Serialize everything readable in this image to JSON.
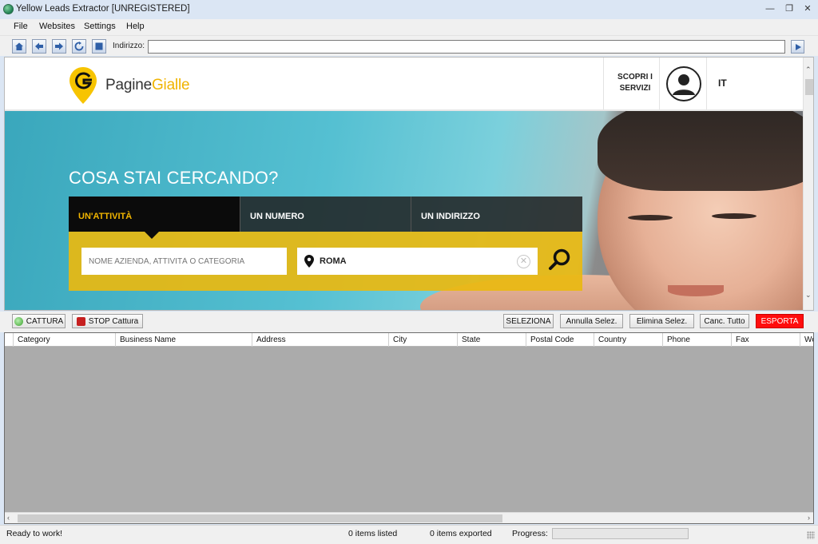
{
  "window": {
    "title": "Yellow Leads Extractor [UNREGISTERED]",
    "controls": [
      "minimize",
      "restore",
      "close"
    ]
  },
  "menu": {
    "items": [
      "File",
      "Websites",
      "Settings",
      "Help"
    ]
  },
  "toolbar": {
    "buttons": [
      "home-icon",
      "back-icon",
      "forward-icon",
      "refresh-icon",
      "stop-icon"
    ],
    "address_label": "Indirizzo:",
    "address_value": "",
    "go_icon": "play-icon"
  },
  "site": {
    "logo_part1": "Pagine",
    "logo_part2": "Gialle",
    "scopri_line1": "SCOPRI I",
    "scopri_line2": "SERVIZI",
    "language": "IT",
    "hero_title": "COSA STAI CERCANDO?",
    "tabs": [
      "UN'ATTIVITÀ",
      "UN NUMERO",
      "UN INDIRIZZO"
    ],
    "active_tab": 0,
    "what_placeholder": "NOME AZIENDA, ATTIVITÀ O CATEGORIA",
    "where_value": "ROMA",
    "brand_color": "#f0b400"
  },
  "actions": {
    "cattura": "CATTURA",
    "stop": "STOP Cattura",
    "seleziona": "SELEZIONA",
    "annulla": "Annulla Selez.",
    "elimina": "Elimina Selez.",
    "canc": "Canc. Tutto",
    "esporta": "ESPORTA"
  },
  "grid": {
    "columns": [
      "Category",
      "Business Name",
      "Address",
      "City",
      "State",
      "Postal Code",
      "Country",
      "Phone",
      "Fax",
      "We"
    ],
    "rows": []
  },
  "status": {
    "message": "Ready to work!",
    "listed": "0 items listed",
    "exported": "0 items exported",
    "progress_label": "Progress:",
    "progress_value": 0
  }
}
